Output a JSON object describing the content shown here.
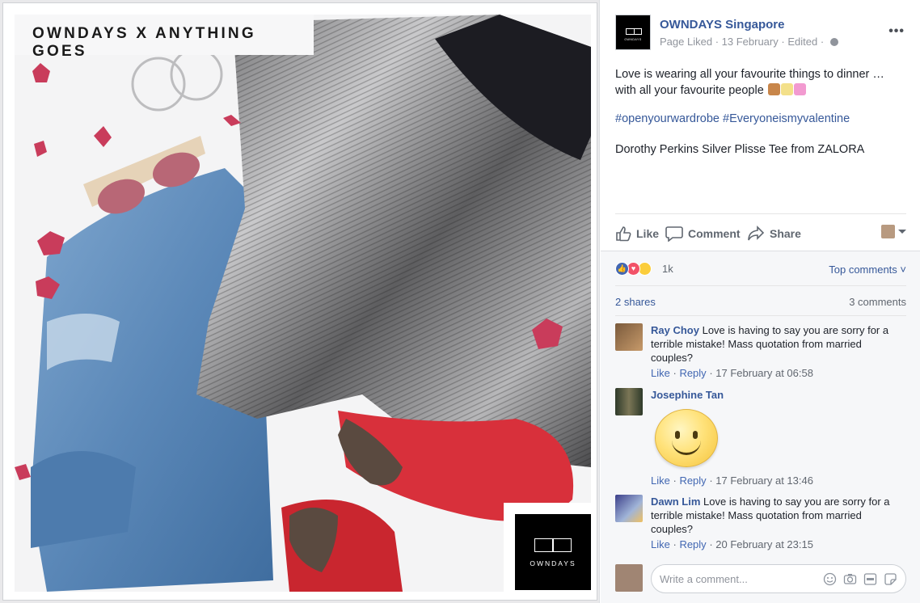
{
  "photo": {
    "title": "OWNDAYS X ANYTHING GOES",
    "brand_label": "OWNDAYS"
  },
  "post": {
    "page_name": "OWNDAYS Singapore",
    "page_status": "Page Liked",
    "date": "13 February",
    "edited": "Edited",
    "avatar_label": "OWNDAYS",
    "text": "Love is wearing all your favourite things to dinner … with all your favourite people",
    "hashtags": "#openyourwardrobe #Everyoneismyvalentine",
    "credit": "Dorothy Perkins Silver Plisse Tee from ZALORA",
    "more": "•••"
  },
  "actions": {
    "like": "Like",
    "comment": "Comment",
    "share": "Share"
  },
  "reactions": {
    "count": "1k",
    "top_comments": "Top comments ˅",
    "shares": "2 shares",
    "comments_count": "3 comments"
  },
  "comments": [
    {
      "name": "Ray Choy",
      "text": "Love is having to say you are sorry for a terrible mistake! Mass quotation from married couples?",
      "like": "Like",
      "reply": "Reply",
      "time": "17 February at 06:58"
    },
    {
      "name": "Josephine Tan",
      "like": "Like",
      "reply": "Reply",
      "time": "17 February at 13:46"
    },
    {
      "name": "Dawn Lim",
      "text": "Love is having to say you are sorry for a terrible mistake! Mass quotation from married couples?",
      "like": "Like",
      "reply": "Reply",
      "time": "20 February at 23:15"
    }
  ],
  "composer": {
    "placeholder": "Write a comment..."
  },
  "colors": {
    "link": "#365899",
    "meta": "#90949c",
    "like_blue": "#4267b2",
    "love_red": "#f25268",
    "wow_yellow": "#fbcd3b"
  }
}
